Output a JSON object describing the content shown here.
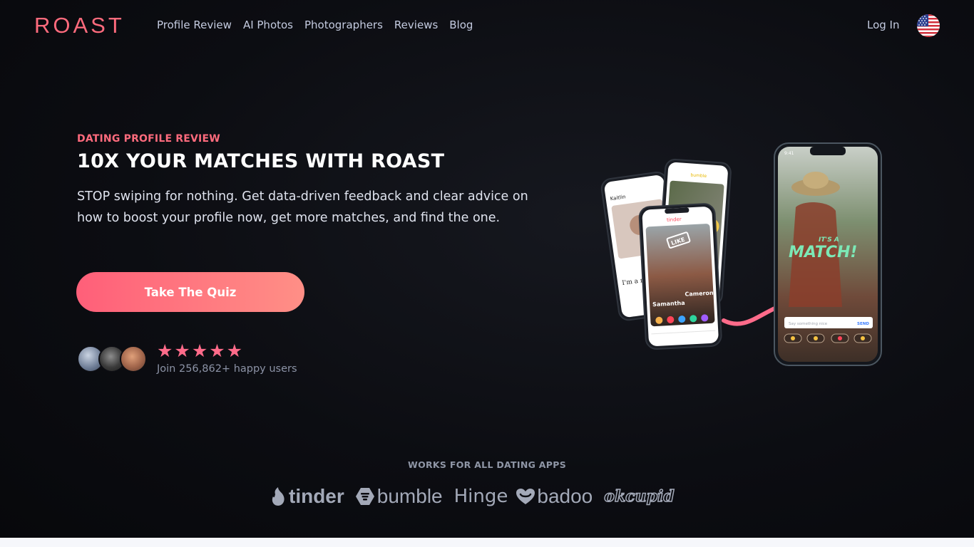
{
  "header": {
    "logo": "ROAST",
    "nav": [
      "Profile Review",
      "AI Photos",
      "Photographers",
      "Reviews",
      "Blog"
    ],
    "login": "Log In",
    "language_flag": "us-flag-icon"
  },
  "hero": {
    "eyebrow": "DATING PROFILE REVIEW",
    "headline": "10X YOUR MATCHES WITH ROAST",
    "subtext": "STOP swiping for nothing. Get data-driven feedback and clear advice on how to boost your profile now, get more matches, and find the one.",
    "cta_label": "Take The Quiz",
    "rating": 5,
    "stars": "★★★★★",
    "social_proof": "Join 256,862+ happy users"
  },
  "phones": {
    "tinder_brand": "tinder",
    "bumble_brand": "bumble",
    "like_stamp": "LIKE",
    "name_left": "Kaitlin",
    "name_a": "Samantha",
    "name_b": "Cameron",
    "quote": "I'm a morn",
    "match_small": "IT'S A",
    "match_big": "MATCH!",
    "message_placeholder": "Say something nice",
    "send_label": "SEND",
    "time": "9:41"
  },
  "apps": {
    "caption": "WORKS FOR ALL DATING APPS",
    "list": [
      "tinder",
      "bumble",
      "Hinge",
      "badoo",
      "okcupid"
    ]
  },
  "colors": {
    "accent": "#ff6b7d",
    "cta_start": "#ff5f79",
    "cta_end": "#ff8f86",
    "match_green": "#7ce8b6"
  }
}
